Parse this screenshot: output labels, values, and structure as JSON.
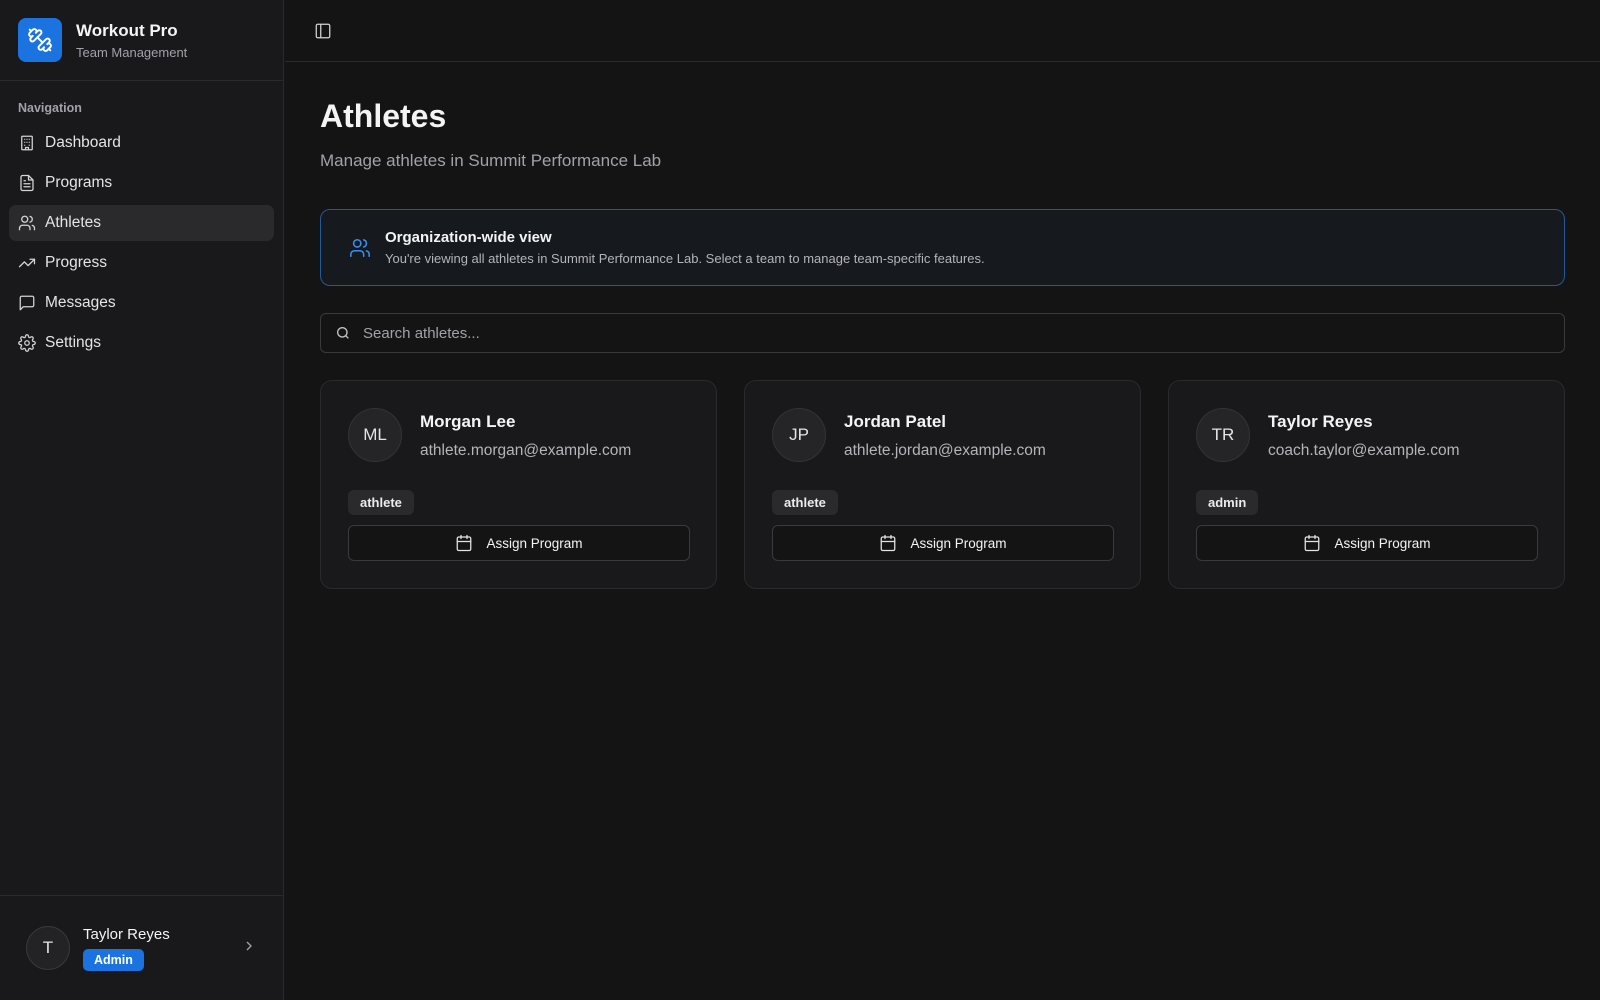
{
  "app": {
    "title": "Workout Pro",
    "subtitle": "Team Management",
    "logo_icon": "dumbbell-icon",
    "accent": "#1b73e0"
  },
  "sidebar": {
    "heading": "Navigation",
    "items": [
      {
        "label": "Dashboard",
        "icon": "building-icon",
        "active": false
      },
      {
        "label": "Programs",
        "icon": "file-text-icon",
        "active": false
      },
      {
        "label": "Athletes",
        "icon": "users-icon",
        "active": true
      },
      {
        "label": "Progress",
        "icon": "trending-up-icon",
        "active": false
      },
      {
        "label": "Messages",
        "icon": "message-square-icon",
        "active": false
      },
      {
        "label": "Settings",
        "icon": "gear-icon",
        "active": false
      }
    ]
  },
  "user": {
    "initial": "T",
    "name": "Taylor Reyes",
    "role": "Admin"
  },
  "page": {
    "title": "Athletes",
    "subtitle": "Manage athletes in Summit Performance Lab"
  },
  "banner": {
    "title": "Organization-wide view",
    "description": "You're viewing all athletes in Summit Performance Lab. Select a team to manage team-specific features."
  },
  "search": {
    "placeholder": "Search athletes...",
    "value": ""
  },
  "athletes": [
    {
      "initials": "ML",
      "name": "Morgan Lee",
      "email": "athlete.morgan@example.com",
      "role": "athlete",
      "action": "Assign Program"
    },
    {
      "initials": "JP",
      "name": "Jordan Patel",
      "email": "athlete.jordan@example.com",
      "role": "athlete",
      "action": "Assign Program"
    },
    {
      "initials": "TR",
      "name": "Taylor Reyes",
      "email": "coach.taylor@example.com",
      "role": "admin",
      "action": "Assign Program"
    }
  ]
}
